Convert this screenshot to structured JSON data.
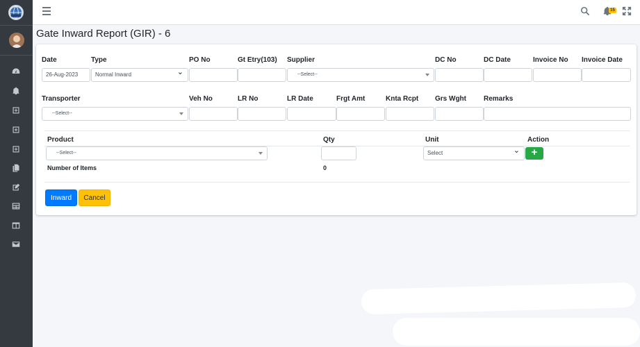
{
  "page": {
    "title": "Gate Inward Report (GIR) - 6"
  },
  "topbar": {
    "notification_count": "15"
  },
  "form": {
    "labels": {
      "date": "Date",
      "type": "Type",
      "po_no": "PO No",
      "gt_etry": "Gt Etry(103)",
      "supplier": "Supplier",
      "dc_no": "DC No",
      "dc_date": "DC Date",
      "invoice_no": "Invoice No",
      "invoice_date": "Invoice Date",
      "transporter": "Transporter",
      "veh_no": "Veh No",
      "lr_no": "LR No",
      "lr_date": "LR Date",
      "frgt_amt": "Frgt Amt",
      "knta_rcpt": "Knta Rcpt",
      "grs_wght": "Grs Wght",
      "remarks": "Remarks"
    },
    "values": {
      "date": "26-Aug-2023",
      "type": "Normal Inward",
      "supplier": "--Select--",
      "transporter": "--Select--"
    }
  },
  "items": {
    "headers": {
      "product": "Product",
      "qty": "Qty",
      "unit": "Unit",
      "action": "Action"
    },
    "product_value": "--Select--",
    "unit_value": "Select",
    "add_label": "+",
    "count_label": "Number of Items",
    "count_value": "0"
  },
  "buttons": {
    "inward": "Inward",
    "cancel": "Cancel"
  },
  "colors": {
    "sidebar": "#343a40",
    "primary": "#007bff",
    "warning": "#ffc107",
    "success": "#28a745"
  }
}
